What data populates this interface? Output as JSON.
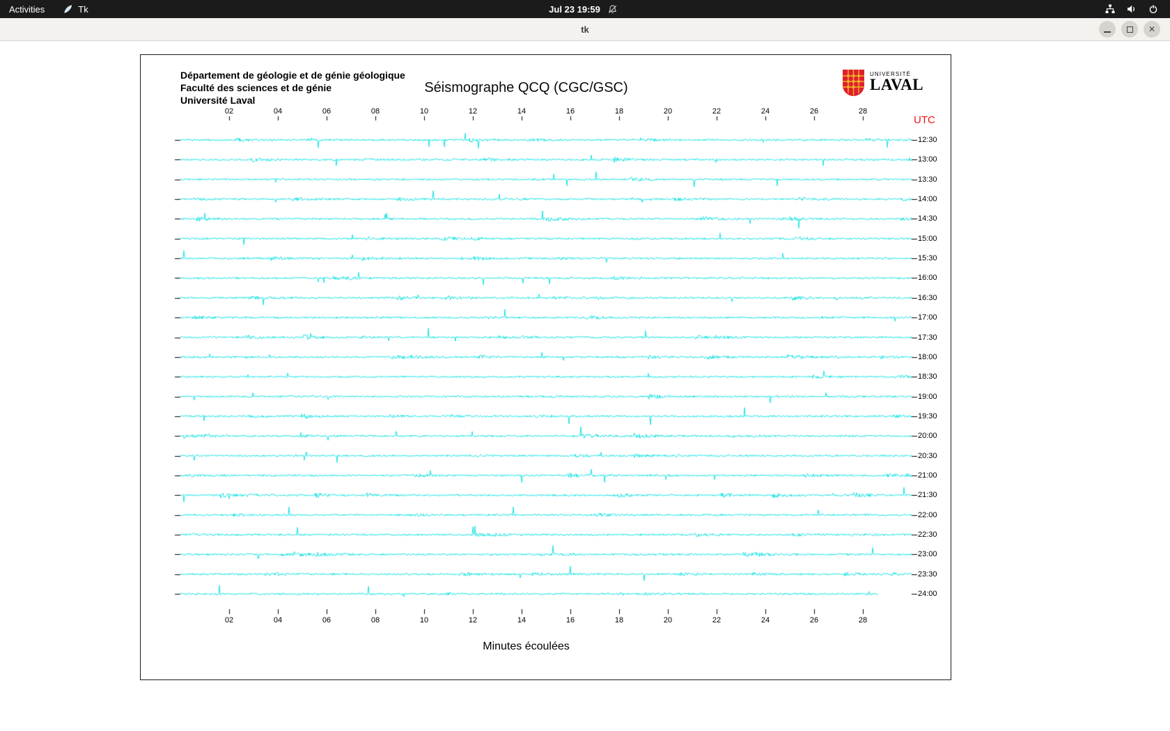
{
  "top_bar": {
    "activities_label": "Activities",
    "app_name": "Tk",
    "clock": "Jul 23 19:59"
  },
  "window": {
    "title": "tk"
  },
  "seismograph": {
    "institution_lines": [
      "Département de géologie et de génie géologique",
      "Faculté des sciences et de génie",
      "Université Laval"
    ],
    "title": "Séismographe QCQ (CGC/GSC)",
    "logo": {
      "line1": "UNIVERSITÉ",
      "line2": "LAVAL",
      "shield_red": "#e01f2d",
      "shield_gold": "#f0b429"
    },
    "utc_label": "UTC",
    "utc_color": "#ee1111",
    "x_axis_title": "Minutes écoulées",
    "x_ticks": [
      "02",
      "04",
      "06",
      "08",
      "10",
      "12",
      "14",
      "16",
      "18",
      "20",
      "22",
      "24",
      "26",
      "28"
    ],
    "minutes_per_line": 30,
    "trace_labels": [
      "12:30",
      "13:00",
      "13:30",
      "14:00",
      "14:30",
      "15:00",
      "15:30",
      "16:00",
      "16:30",
      "17:00",
      "17:30",
      "18:00",
      "18:30",
      "19:00",
      "19:30",
      "20:00",
      "20:30",
      "21:00",
      "21:30",
      "22:00",
      "22:30",
      "23:00",
      "23:30",
      "24:00"
    ],
    "trace_color": "#00e0e0",
    "tick_color": "#000000",
    "last_trace_fraction": 0.953
  }
}
